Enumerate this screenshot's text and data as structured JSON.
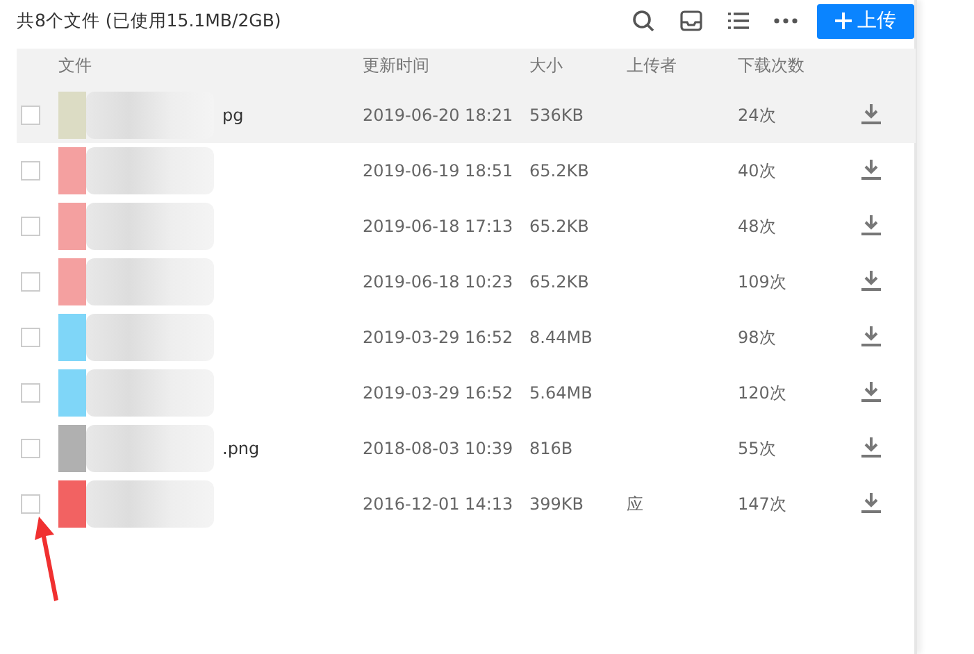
{
  "header": {
    "summary": "共8个文件 (已使用15.1MB/2GB)",
    "upload_button": "上传"
  },
  "table": {
    "columns": [
      "文件",
      "更新时间",
      "大小",
      "上传者",
      "下载次数"
    ],
    "rows": [
      {
        "name": "pg",
        "updated": "2019-06-20 18:21",
        "size": "536KB",
        "uploader": "",
        "downloads": "24次",
        "checked": false,
        "highlighted": true,
        "color": "#dcdcc4"
      },
      {
        "name": "",
        "updated": "2019-06-19 18:51",
        "size": "65.2KB",
        "uploader": "",
        "downloads": "40次",
        "checked": false,
        "highlighted": false,
        "color": "#f4a0a0"
      },
      {
        "name": "",
        "updated": "2019-06-18 17:13",
        "size": "65.2KB",
        "uploader": "",
        "downloads": "48次",
        "checked": false,
        "highlighted": false,
        "color": "#f4a0a0"
      },
      {
        "name": "",
        "updated": "2019-06-18 10:23",
        "size": "65.2KB",
        "uploader": "",
        "downloads": "109次",
        "checked": false,
        "highlighted": false,
        "color": "#f4a0a0"
      },
      {
        "name": "",
        "updated": "2019-03-29 16:52",
        "size": "8.44MB",
        "uploader": "",
        "downloads": "98次",
        "checked": false,
        "highlighted": false,
        "color": "#7fd6f8"
      },
      {
        "name": "",
        "updated": "2019-03-29 16:52",
        "size": "5.64MB",
        "uploader": "",
        "downloads": "120次",
        "checked": false,
        "highlighted": false,
        "color": "#7fd6f8"
      },
      {
        "name": ".png",
        "updated": "2018-08-03 10:39",
        "size": "816B",
        "uploader": "",
        "downloads": "55次",
        "checked": false,
        "highlighted": false,
        "color": "#b0b0b0"
      },
      {
        "name": "",
        "updated": "2016-12-01 14:13",
        "size": "399KB",
        "uploader": "应",
        "downloads": "147次",
        "checked": false,
        "highlighted": false,
        "color": "#f26262"
      }
    ]
  }
}
